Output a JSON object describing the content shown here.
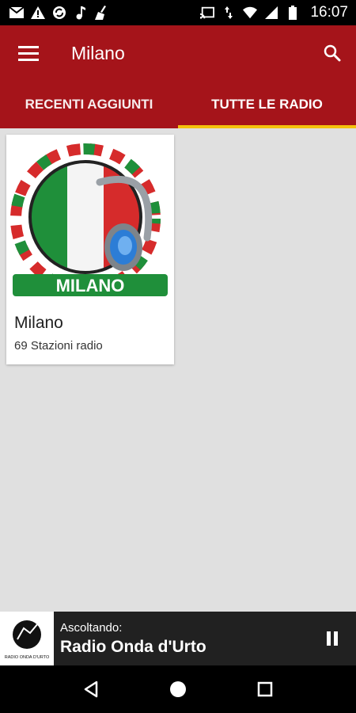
{
  "status_bar": {
    "time": "16:07",
    "left_icons": [
      "mail-icon",
      "warning-icon",
      "sync-icon",
      "music-note-icon",
      "broom-icon"
    ],
    "right_icons": [
      "cast-icon",
      "data-arrows-icon",
      "wifi-icon",
      "signal-icon",
      "battery-icon"
    ]
  },
  "app_bar": {
    "title": "Milano",
    "menu_icon": "menu-icon",
    "search_icon": "search-icon"
  },
  "tabs": [
    {
      "label": "RECENTI AGGIUNTI",
      "active": false
    },
    {
      "label": "TUTTE LE RADIO",
      "active": true
    }
  ],
  "cards": [
    {
      "image_label": "MILANO",
      "title": "Milano",
      "subtitle": "69 Stazioni radio"
    }
  ],
  "player": {
    "label": "Ascoltando:",
    "station": "Radio Onda d'Urto",
    "thumb_caption": "RADIO ONDA D'URTO",
    "pause_icon": "pause-icon"
  },
  "nav_bar": {
    "icons": [
      "back-icon",
      "home-icon",
      "recents-icon"
    ]
  },
  "colors": {
    "primary": "#a5141a",
    "tab_indicator": "#f4c20d",
    "background": "#e0e0e0",
    "player_bg": "#212121"
  }
}
